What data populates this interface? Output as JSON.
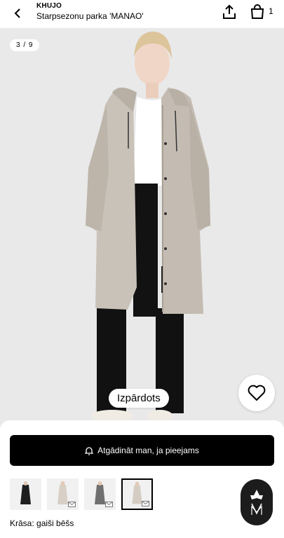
{
  "header": {
    "brand": "KHUJO",
    "title": "Starpsezonu parka 'MANAO'",
    "cart_count": "1"
  },
  "gallery": {
    "counter": "3 / 9",
    "badge": "Izpārdots"
  },
  "actions": {
    "notify_label": "Atgādināt man, ja pieejams"
  },
  "variants": {
    "thumbnails": [
      {
        "name": "black",
        "color": "#1f1f1f",
        "selected": false
      },
      {
        "name": "light-beige",
        "color": "#d8cfc6",
        "selected": false
      },
      {
        "name": "grey",
        "color": "#6f6f6f",
        "selected": false
      },
      {
        "name": "light-beige-alt",
        "color": "#d5cdc3",
        "selected": true
      }
    ],
    "color_label": "Krāsa: gaiši bēšs"
  },
  "colors": {
    "accent": "#000000",
    "background": "#e9e9ea",
    "coat": "#c9c2b8"
  },
  "icons": [
    "back-icon",
    "share-icon",
    "shopping-bag-icon",
    "heart-icon",
    "bell-icon",
    "mail-icon",
    "chat-assistant-icon"
  ]
}
